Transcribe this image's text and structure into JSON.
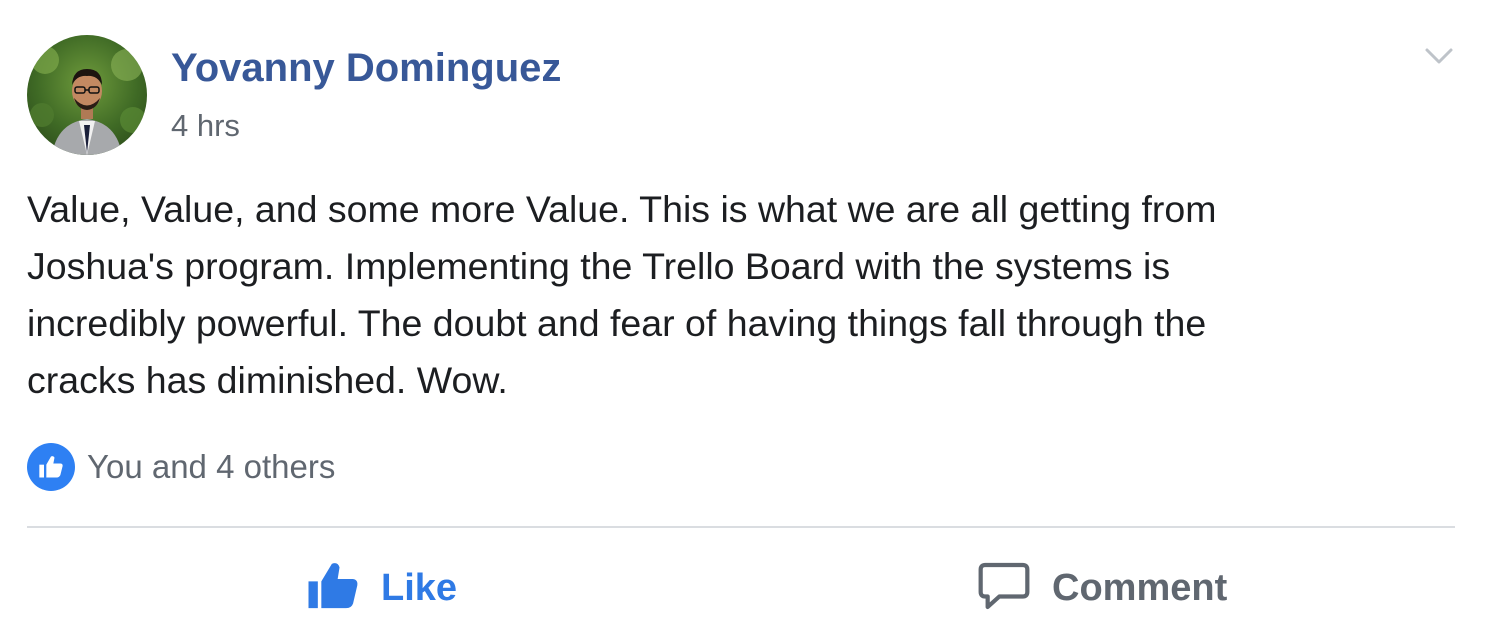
{
  "post": {
    "author": "Yovanny Dominguez",
    "timestamp": "4 hrs",
    "text_lines": [
      "Value, Value, and some more Value. This is what we are all getting from",
      "Joshua's program. Implementing the Trello Board with the systems is",
      "incredibly powerful. The doubt and fear of having things fall through the",
      "cracks has diminished. Wow."
    ],
    "reactions": {
      "icon": "like-icon",
      "summary": "You and 4 others"
    }
  },
  "actions": {
    "like_label": "Like",
    "comment_label": "Comment"
  },
  "colors": {
    "author_name": "#385898",
    "secondary_text": "#606770",
    "body_text": "#1c1e21",
    "like_active": "#2f7ae5",
    "like_badge": "#2e80f3",
    "divider": "#dadde1"
  },
  "icons": {
    "menu": "chevron-down-icon",
    "like": "thumbs-up-icon",
    "comment": "speech-bubble-icon"
  }
}
